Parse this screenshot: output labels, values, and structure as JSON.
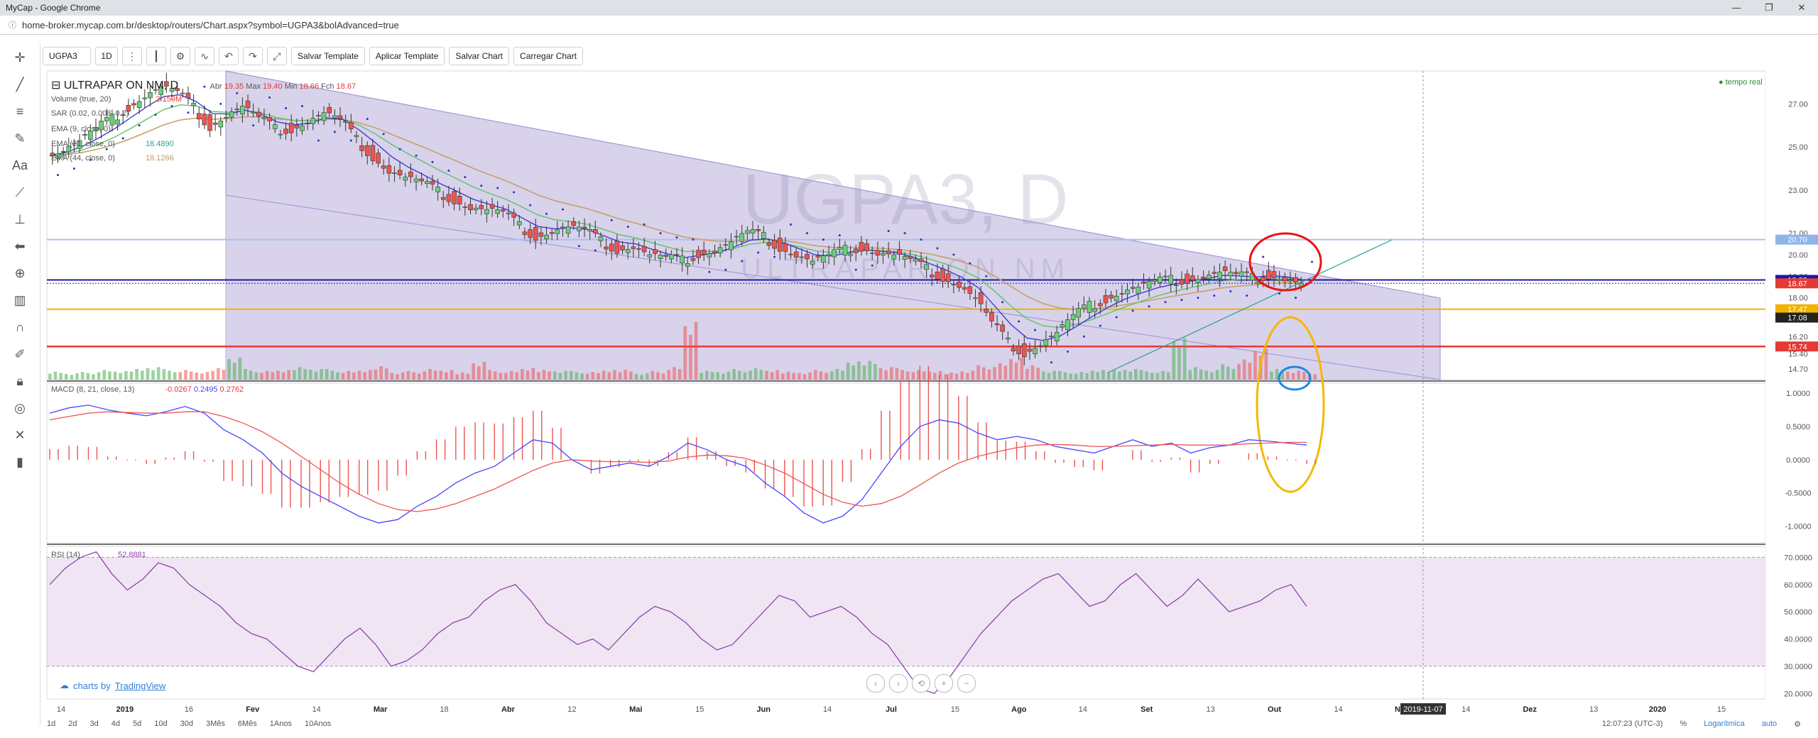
{
  "window": {
    "title": "MyCap - Google Chrome",
    "url": "home-broker.mycap.com.br/desktop/routers/Chart.aspx?symbol=UGPA3&bolAdvanced=true",
    "buttons": [
      "—",
      "❐",
      "✕"
    ]
  },
  "toolbar": {
    "symbol": "UGPA3",
    "interval": "1D",
    "save_template": "Salvar Template",
    "apply_template": "Aplicar Template",
    "save_chart": "Salvar Chart",
    "load_chart": "Carregar Chart"
  },
  "left_tools": [
    "crosshair-icon",
    "trendline-icon",
    "fib-icon",
    "brush-icon",
    "text-icon",
    "pattern-icon",
    "measure-icon",
    "arrow-icon",
    "zoom-icon",
    "ruler-icon",
    "magnet-icon",
    "lock-pencil-icon",
    "lock-icon",
    "eye-icon",
    "wrench-icon",
    "trash-icon"
  ],
  "legend": {
    "instrument": "ULTRAPAR ON NM, D",
    "ohlc": {
      "o_label": "Abr",
      "o": "19.35",
      "h_label": "Max",
      "h": "19.40",
      "l_label": "Min",
      "l": "18.66",
      "c_label": "Fch",
      "c": "18.67"
    },
    "volume": {
      "name": "Volume (true, 20)",
      "value": "2.159M"
    },
    "sar": {
      "name": "SAR (0.02, 0.008, 0.2)"
    },
    "ema9": {
      "name": "EMA (9, close, 0)"
    },
    "ema21": {
      "name": "EMA (21, close, 0)",
      "value": "18.4890"
    },
    "ema_other": {
      "name": "EMA (44, close, 0)",
      "value": "18.1266"
    },
    "realtime": "tempo real",
    "watermark_main": "UGPA3, D",
    "watermark_sub": "ULTRAPAR ON NM"
  },
  "macd_legend": {
    "name": "MACD (8, 21, close, 13)",
    "values": [
      "-0.0267",
      "0.2495",
      "0.2762"
    ]
  },
  "rsi_legend": {
    "name": "RSI (14)",
    "value": "52.8881"
  },
  "chart_data": [
    {
      "type": "candlestick",
      "title": "ULTRAPAR ON NM, D",
      "x": [
        "Dez",
        "2019",
        "Fev",
        "Mar",
        "Abr",
        "Mai",
        "Jun",
        "Jul",
        "Ago",
        "Set",
        "Out",
        "Nov",
        "Dez",
        "2020"
      ],
      "ylim": [
        14.2,
        28.2
      ],
      "y_ticks": [
        "27.00",
        "25.00",
        "23.00",
        "21.00",
        "20.00",
        "19.00",
        "18.00",
        "17.00",
        "16.20",
        "15.40",
        "14.70"
      ],
      "x_ticks": [
        "14",
        "2019",
        "16",
        "Fev",
        "14",
        "Mar",
        "18",
        "Abr",
        "12",
        "Mai",
        "15",
        "Jun",
        "14",
        "Jul",
        "15",
        "Ago",
        "14",
        "Set",
        "13",
        "Out",
        "14",
        "Nov",
        "14",
        "Dez",
        "13",
        "2020",
        "15"
      ],
      "crosshair_label": "2019-11-07",
      "price_labels": [
        {
          "value": "20.70",
          "color": "#8fb4e8"
        },
        {
          "value": "18.83",
          "color": "#1a1aa6"
        },
        {
          "value": "18.67",
          "color": "#e53935"
        },
        {
          "value": "17.47",
          "color": "#f0b400"
        },
        {
          "value": "17.08",
          "color": "#222222"
        },
        {
          "value": "15.74",
          "color": "#e53935"
        }
      ],
      "close_path": [
        24.6,
        24.9,
        25.3,
        25.8,
        26.3,
        26.9,
        27.4,
        27.8,
        27.5,
        26.8,
        26.0,
        26.5,
        26.9,
        26.3,
        25.8,
        25.9,
        26.2,
        26.6,
        26.2,
        25.3,
        24.6,
        23.9,
        23.6,
        23.3,
        22.9,
        22.6,
        22.2,
        22.1,
        21.9,
        21.3,
        20.9,
        21.1,
        21.3,
        21.1,
        20.6,
        20.3,
        20.4,
        20.0,
        19.8,
        19.7,
        20.1,
        20.2,
        20.6,
        21.0,
        20.8,
        20.4,
        20.0,
        19.7,
        19.9,
        20.2,
        20.4,
        20.1,
        20.0,
        19.7,
        19.3,
        19.0,
        18.6,
        18.0,
        16.8,
        15.9,
        15.5,
        15.9,
        16.4,
        17.1,
        17.6,
        18.0,
        18.3,
        18.5,
        18.7,
        18.8,
        18.9,
        19.0,
        19.2,
        19.0,
        18.9,
        19.1,
        18.9,
        18.67
      ],
      "volume_path": [
        0.9,
        0.7,
        0.8,
        1.0,
        0.9,
        1.2,
        1.4,
        1.1,
        1.0,
        0.8,
        1.3,
        2.5,
        1.1,
        0.9,
        1.0,
        1.4,
        1.2,
        1.1,
        0.9,
        1.0,
        1.5,
        0.8,
        0.9,
        1.1,
        1.0,
        0.8,
        2.0,
        1.0,
        0.9,
        1.2,
        1.1,
        1.0,
        0.9,
        0.8,
        1.0,
        1.1,
        0.7,
        0.9,
        1.3,
        6.0,
        1.0,
        0.9,
        1.1,
        1.2,
        1.0,
        0.9,
        0.8,
        1.0,
        1.1,
        1.9,
        2.1,
        1.4,
        1.2,
        1.0,
        0.9,
        0.8,
        1.0,
        1.5,
        1.7,
        2.3,
        1.6,
        1.0,
        0.9,
        0.8,
        1.0,
        1.1,
        1.2,
        1.0,
        0.9,
        4.3,
        1.4,
        1.1,
        1.6,
        2.1,
        3.2,
        1.2,
        1.0,
        0.8
      ]
    },
    {
      "type": "line",
      "title": "MACD (8, 21, close, 13)",
      "ylim": [
        -1.25,
        1.15
      ],
      "y_ticks": [
        "1.0000",
        "0.5000",
        "0.0000",
        "-0.5000",
        "-1.0000"
      ],
      "series": [
        {
          "name": "MACD",
          "color": "#4646ff",
          "values": [
            0.7,
            0.78,
            0.82,
            0.75,
            0.7,
            0.66,
            0.72,
            0.8,
            0.7,
            0.45,
            0.3,
            0.1,
            -0.2,
            -0.4,
            -0.55,
            -0.7,
            -0.85,
            -0.95,
            -0.9,
            -0.7,
            -0.55,
            -0.35,
            -0.2,
            -0.1,
            0.1,
            0.3,
            0.25,
            0.0,
            -0.15,
            -0.1,
            -0.05,
            -0.1,
            0.05,
            0.25,
            0.15,
            0.0,
            -0.1,
            -0.35,
            -0.55,
            -0.8,
            -0.95,
            -0.85,
            -0.6,
            -0.2,
            0.2,
            0.5,
            0.6,
            0.55,
            0.4,
            0.3,
            0.35,
            0.3,
            0.2,
            0.15,
            0.1,
            0.2,
            0.3,
            0.2,
            0.25,
            0.1,
            0.18,
            0.22,
            0.3,
            0.28,
            0.25,
            0.22
          ]
        },
        {
          "name": "Signal",
          "color": "#ef5350",
          "values": [
            0.6,
            0.65,
            0.7,
            0.72,
            0.71,
            0.7,
            0.7,
            0.72,
            0.72,
            0.65,
            0.55,
            0.42,
            0.25,
            0.05,
            -0.15,
            -0.35,
            -0.52,
            -0.66,
            -0.75,
            -0.78,
            -0.74,
            -0.66,
            -0.55,
            -0.44,
            -0.3,
            -0.16,
            -0.05,
            0.0,
            -0.02,
            -0.03,
            -0.03,
            -0.04,
            -0.02,
            0.04,
            0.07,
            0.06,
            0.02,
            -0.08,
            -0.2,
            -0.36,
            -0.52,
            -0.64,
            -0.7,
            -0.66,
            -0.55,
            -0.38,
            -0.2,
            -0.05,
            0.05,
            0.12,
            0.18,
            0.22,
            0.23,
            0.22,
            0.2,
            0.2,
            0.21,
            0.22,
            0.23,
            0.22,
            0.22,
            0.22,
            0.24,
            0.25,
            0.26,
            0.26
          ]
        }
      ]
    },
    {
      "type": "line",
      "title": "RSI (14)",
      "ylim": [
        18,
        74
      ],
      "y_ticks": [
        "70.0000",
        "60.0000",
        "50.0000",
        "40.0000",
        "30.0000",
        "20.0000"
      ],
      "series": [
        {
          "name": "RSI",
          "color": "#8e44ad",
          "values": [
            60,
            66,
            70,
            72,
            64,
            58,
            62,
            68,
            66,
            60,
            56,
            52,
            46,
            42,
            40,
            35,
            30,
            28,
            34,
            40,
            44,
            38,
            30,
            32,
            36,
            42,
            46,
            48,
            54,
            58,
            60,
            54,
            46,
            42,
            38,
            40,
            36,
            42,
            48,
            52,
            50,
            46,
            40,
            36,
            38,
            44,
            50,
            56,
            54,
            48,
            50,
            52,
            48,
            42,
            38,
            30,
            22,
            20,
            26,
            34,
            42,
            48,
            54,
            58,
            62,
            64,
            58,
            52,
            54,
            60,
            64,
            58,
            52,
            56,
            62,
            56,
            50,
            52,
            54,
            58,
            60,
            52
          ]
        }
      ]
    }
  ],
  "bottom_bar": {
    "ranges": [
      "1d",
      "2d",
      "3d",
      "4d",
      "5d",
      "10d",
      "30d",
      "3Mês",
      "6Mês",
      "1Anos",
      "10Anos"
    ],
    "time": "12:07:23 (UTC-3)",
    "percent": "%",
    "log": "Logarítmica",
    "auto": "auto"
  },
  "branding": {
    "text": "charts by",
    "link": "TradingView"
  }
}
